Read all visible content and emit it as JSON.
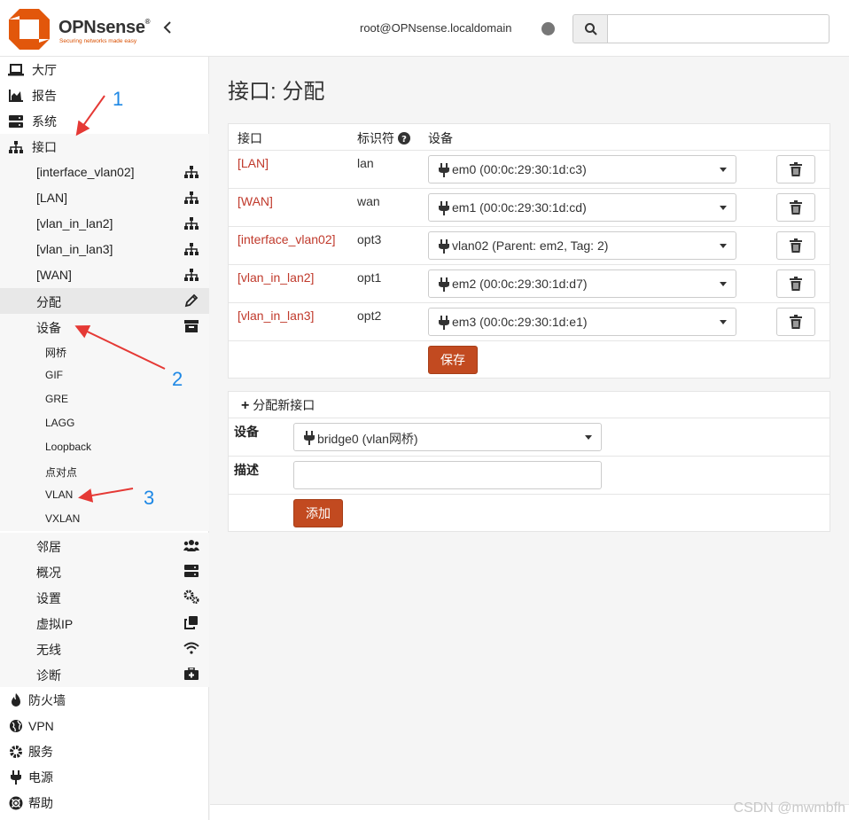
{
  "header": {
    "brand": "OPNsense",
    "brand_mark": "®",
    "tagline": "Securing networks made easy",
    "collapse_glyph": "‹",
    "user": "root@OPNsense.localdomain",
    "search_placeholder": ""
  },
  "sidebar": {
    "top_items": [
      {
        "label": "大厅",
        "icon": "laptop-icon"
      },
      {
        "label": "报告",
        "icon": "chart-icon"
      },
      {
        "label": "系统",
        "icon": "server-icon"
      },
      {
        "label": "接口",
        "icon": "sitemap-icon"
      }
    ],
    "interface_items": [
      {
        "label": "[interface_vlan02]",
        "icon": "sitemap-icon"
      },
      {
        "label": "[LAN]",
        "icon": "sitemap-icon"
      },
      {
        "label": "[vlan_in_lan2]",
        "icon": "sitemap-icon"
      },
      {
        "label": "[vlan_in_lan3]",
        "icon": "sitemap-icon"
      },
      {
        "label": "[WAN]",
        "icon": "sitemap-icon"
      },
      {
        "label": "分配",
        "icon": "pencil-icon",
        "active": true
      },
      {
        "label": "设备",
        "icon": "archive-icon"
      }
    ],
    "device_items": [
      "网桥",
      "GIF",
      "GRE",
      "LAGG",
      "Loopback",
      "点对点",
      "VLAN",
      "VXLAN"
    ],
    "interface_items_2": [
      {
        "label": "邻居",
        "icon": "users-icon"
      },
      {
        "label": "概况",
        "icon": "server-icon"
      },
      {
        "label": "设置",
        "icon": "cogs-icon"
      },
      {
        "label": "虚拟IP",
        "icon": "clone-icon"
      },
      {
        "label": "无线",
        "icon": "wifi-icon"
      },
      {
        "label": "诊断",
        "icon": "medkit-icon"
      }
    ],
    "bottom_items": [
      {
        "label": "防火墙",
        "icon": "fire-icon"
      },
      {
        "label": "VPN",
        "icon": "globe-icon"
      },
      {
        "label": "服务",
        "icon": "cog-icon"
      },
      {
        "label": "电源",
        "icon": "plug-icon"
      },
      {
        "label": "帮助",
        "icon": "lifebuoy-icon"
      }
    ]
  },
  "main": {
    "title": "接口: 分配",
    "table_headers": {
      "interface": "接口",
      "identifier": "标识符",
      "device": "设备"
    },
    "rows": [
      {
        "name": "[LAN]",
        "id": "lan",
        "device": "em0 (00:0c:29:30:1d:c3)"
      },
      {
        "name": "[WAN]",
        "id": "wan",
        "device": "em1 (00:0c:29:30:1d:cd)"
      },
      {
        "name": "[interface_vlan02]",
        "id": "opt3",
        "device": "vlan02 (Parent: em2, Tag: 2)"
      },
      {
        "name": "[vlan_in_lan2]",
        "id": "opt1",
        "device": "em2 (00:0c:29:30:1d:d7)"
      },
      {
        "name": "[vlan_in_lan3]",
        "id": "opt2",
        "device": "em3 (00:0c:29:30:1d:e1)"
      }
    ],
    "save_label": "保存",
    "new_if": {
      "header": "分配新接口",
      "device_label": "设备",
      "device_value": "bridge0 (vlan网桥)",
      "desc_label": "描述",
      "desc_value": "",
      "add_label": "添加"
    }
  },
  "annotations": {
    "n1": "1",
    "n2": "2",
    "n3": "3",
    "color": "#1e88e5",
    "arrow_color": "#e53935"
  },
  "watermark": "CSDN @mwmbfh",
  "colors": {
    "accent": "#c24a20",
    "link": "#c0392b",
    "brand_orange": "#e2570b"
  }
}
